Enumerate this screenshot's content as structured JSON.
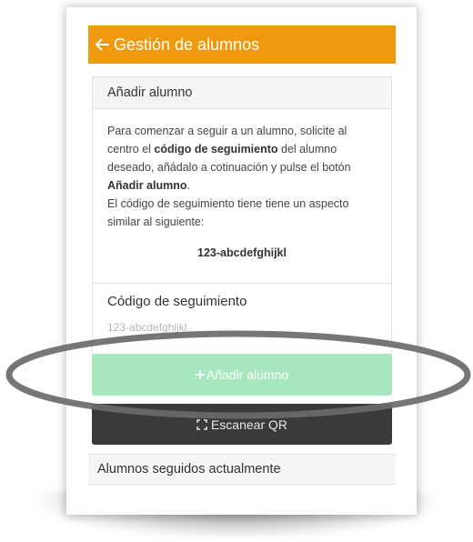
{
  "header": {
    "title": "Gestión de alumnos",
    "back_icon": "arrow-left-icon",
    "color": "#ef9a0e"
  },
  "add_card": {
    "title": "Añadir alumno",
    "instructions": {
      "part1": "Para comenzar a seguir a un alumno, solicite al centro el ",
      "bold1": "código de seguimiento",
      "part2": " del alumno deseado, añádalo a cotinuación y pulse el botón ",
      "bold2": "Añadir alumno",
      "part3": ".",
      "line2": "El código de seguimiento tiene tiene un aspecto similar al siguiente:"
    },
    "sample_code": "123-abcdefghijkl",
    "field_label": "Código de seguimiento",
    "field_placeholder": "123-abcdefghijkl",
    "field_value": ""
  },
  "buttons": {
    "add_label": "Añadir alumno",
    "add_icon": "plus-icon",
    "add_color": "#a7e7c0",
    "qr_label": "Escanear QR",
    "qr_icon": "qr-scan-icon",
    "qr_color": "#3a3a3a"
  },
  "followed": {
    "title": "Alumnos seguidos actualmente"
  }
}
